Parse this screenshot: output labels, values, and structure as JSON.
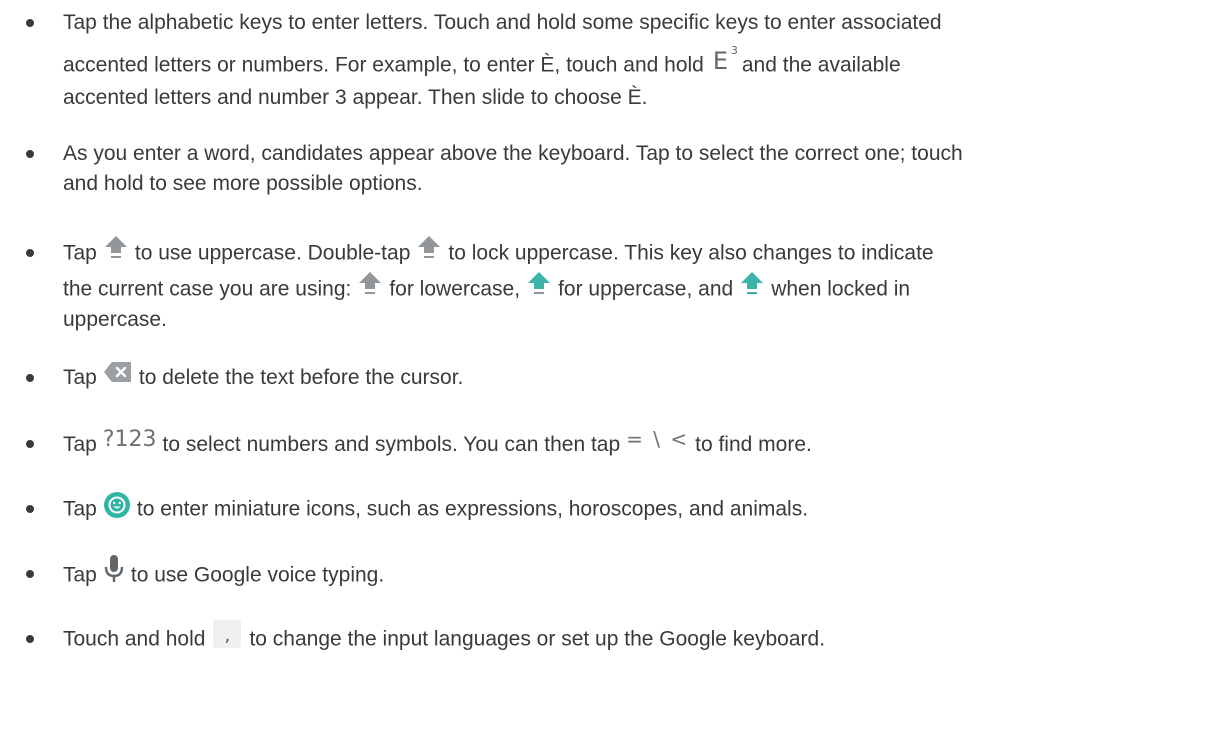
{
  "items": [
    {
      "lines": [
        "Tap the alphabetic keys to enter letters. Touch and hold some specific keys to enter associated",
        {
          "before": "accented letters or numbers. For example, to enter È, touch and hold",
          "key_letter": "E",
          "key_sup": "3",
          "after": "and the available"
        },
        "accented letters and number 3 appear. Then slide to choose È."
      ]
    },
    {
      "lines": [
        "As you enter a word, candidates appear above the keyboard. Tap to select the correct one; touch",
        "and hold to see more possible options."
      ]
    },
    {
      "line1": {
        "t1": "Tap",
        "t2": "to use uppercase. Double-tap",
        "t3": "to lock uppercase. This key also changes to indicate"
      },
      "line2": {
        "t1": "the current case you are using:",
        "t2": "for lowercase,",
        "t3": "for uppercase, and",
        "t4": "when locked in"
      },
      "line3": "uppercase."
    },
    {
      "t1": "Tap",
      "t2": "to delete the text before the cursor."
    },
    {
      "t1": "Tap",
      "key1": "?123",
      "t2": "to select numbers and symbols. You can then tap",
      "key2": "= \\ <",
      "t3": "to find more."
    },
    {
      "t1": "Tap",
      "t2": "to enter miniature icons, such as expressions, horoscopes, and animals."
    },
    {
      "t1": "Tap",
      "t2": "to use Google voice typing."
    },
    {
      "t1": "Touch and hold",
      "key": ",",
      "t2": "to change the input languages or set up the Google keyboard."
    }
  ],
  "icons": {
    "shift_gray": "#909699",
    "shift_teal": "#3bb3a6",
    "delete_bg": "#9aa0a4",
    "emoji_bg": "#30b5a5",
    "mic_color": "#5f6569"
  }
}
